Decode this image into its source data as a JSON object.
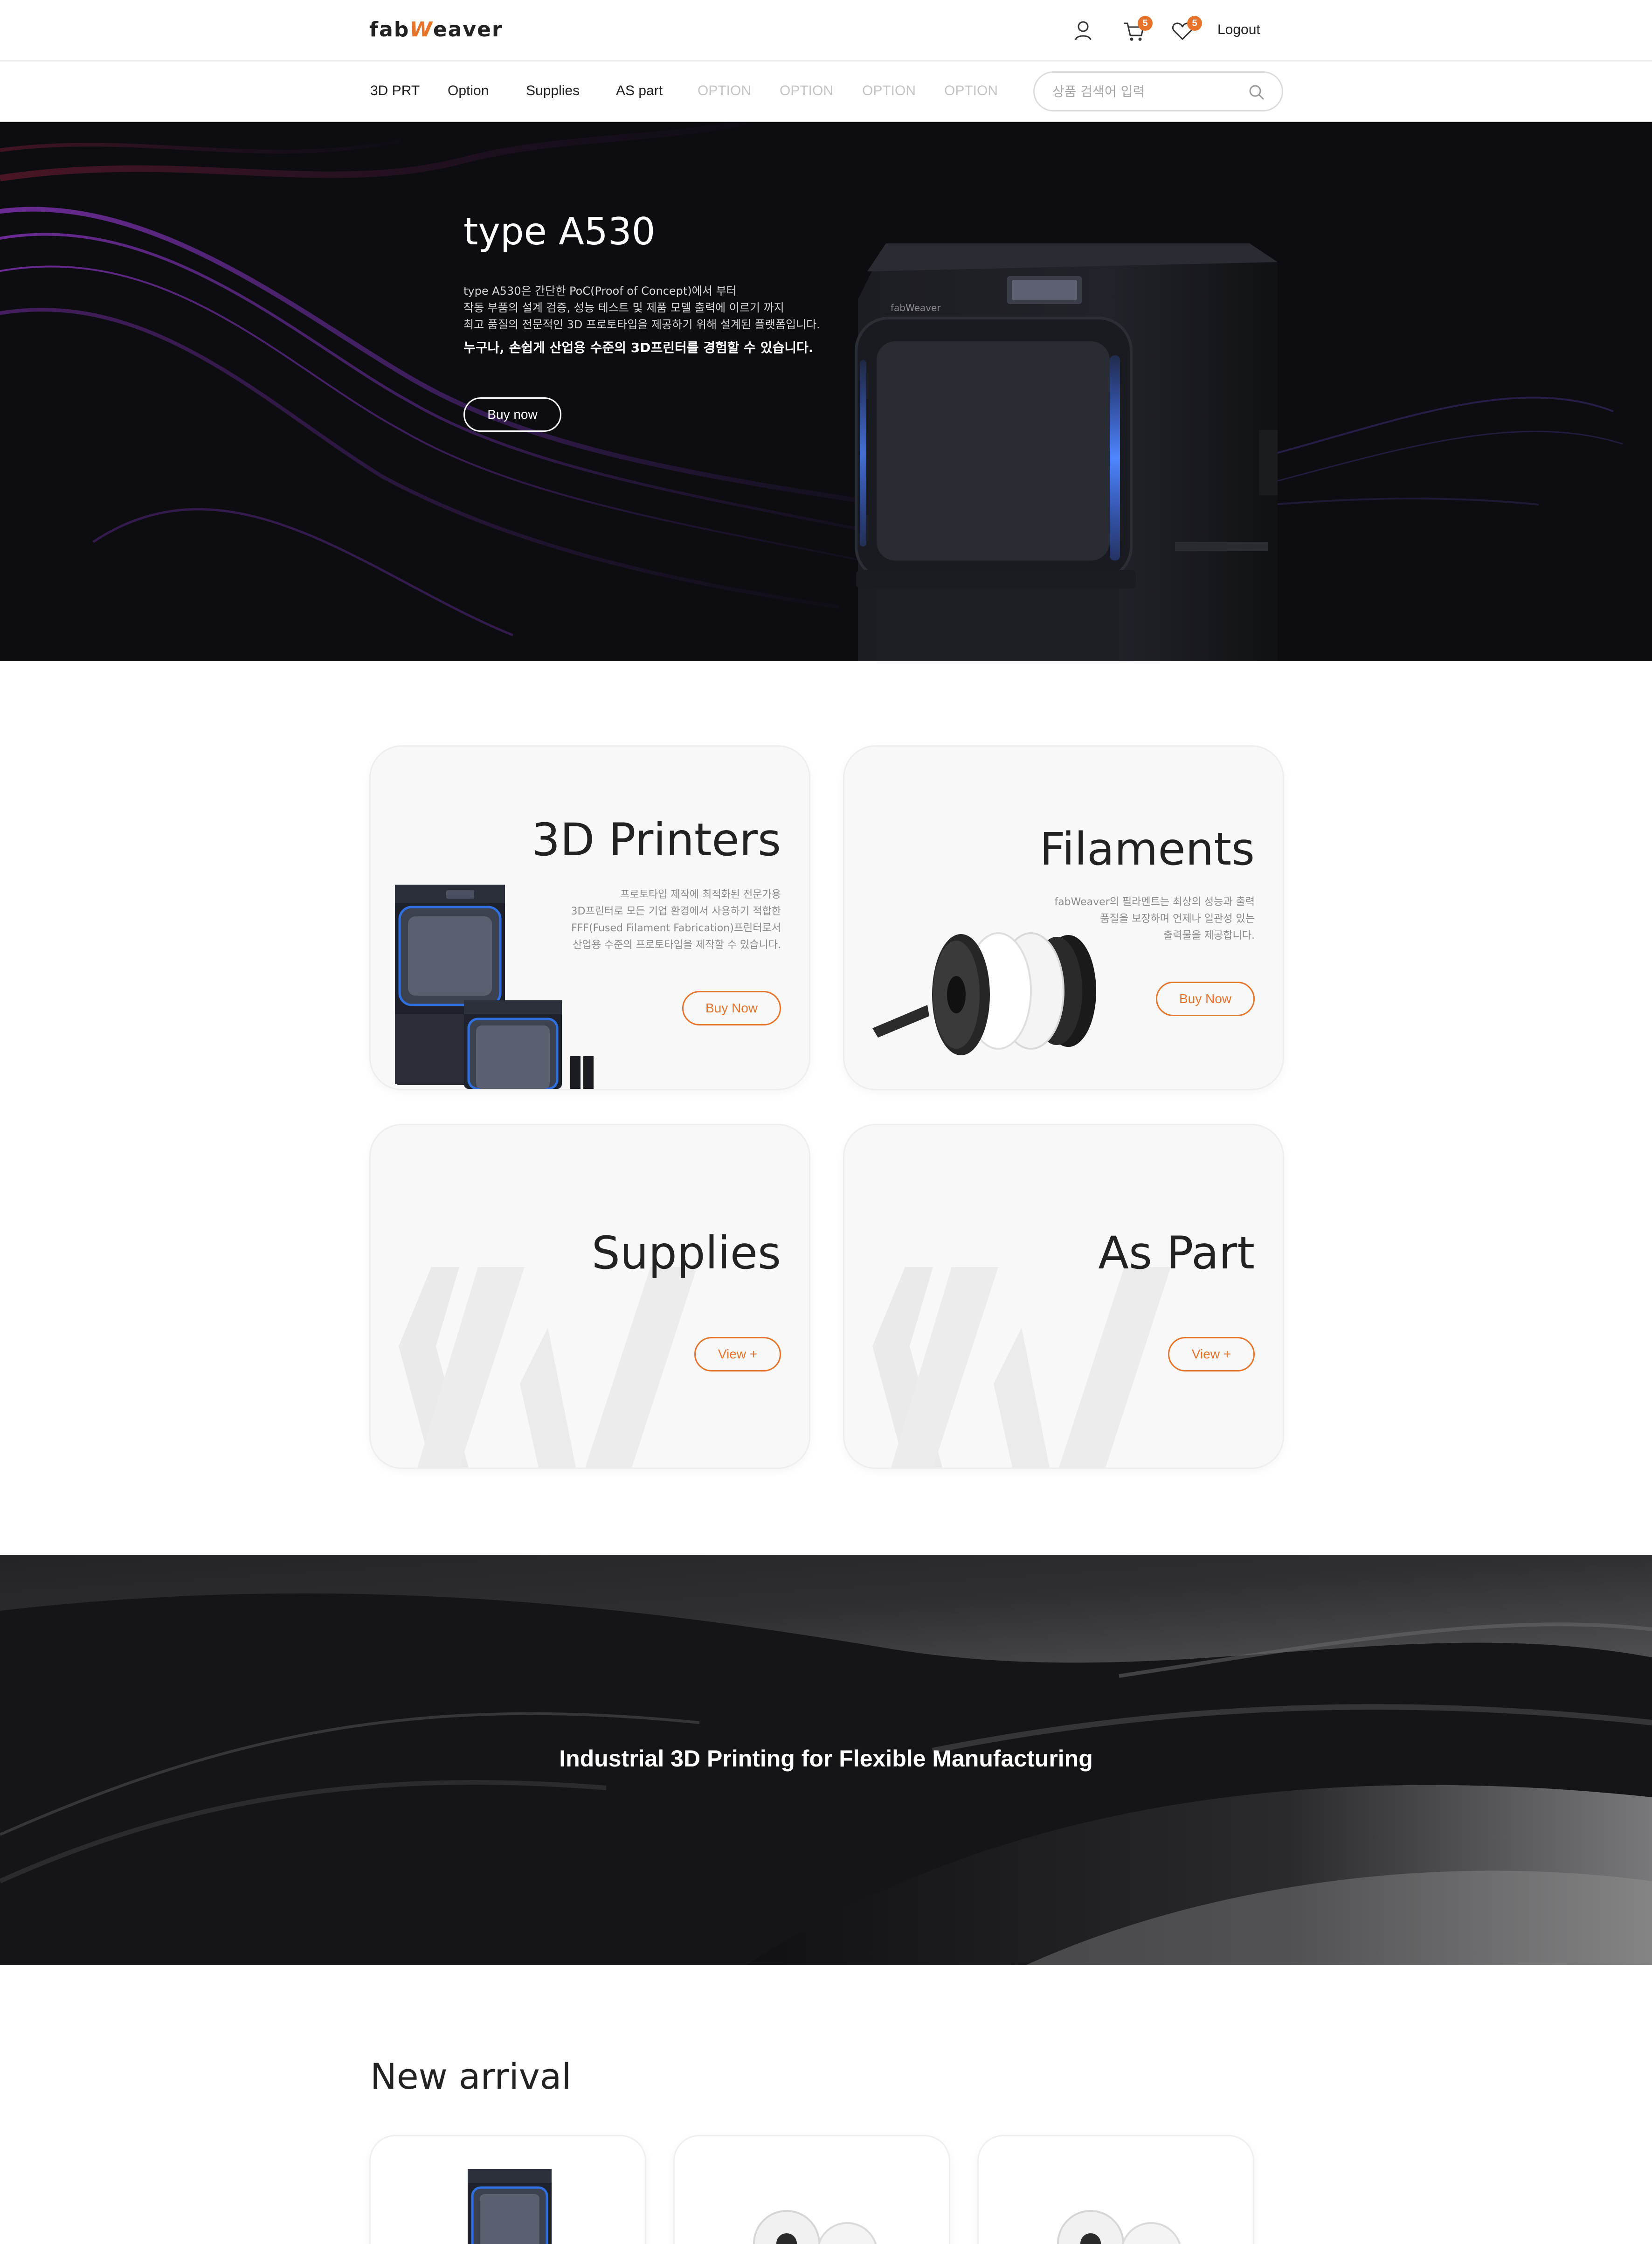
{
  "header": {
    "logo_text_a": "fab",
    "logo_text_w": "W",
    "logo_text_b": "eaver",
    "cart_count": "5",
    "wishlist_count": "5",
    "logout_label": "Logout",
    "icons": [
      "user-icon",
      "cart-icon",
      "heart-icon"
    ]
  },
  "nav": {
    "items": [
      "3D PRT",
      "Option",
      "Supplies",
      "AS part",
      "OPTION",
      "OPTION",
      "OPTION",
      "OPTION"
    ],
    "search_placeholder": "상품 검색어 입력"
  },
  "hero": {
    "title": "type A530",
    "desc_lines": [
      "type A530은 간단한 PoC(Proof of Concept)에서 부터",
      "작동 부품의 설계 검증, 성능 테스트 및 제품 모델 출력에 이르기 까지",
      "최고 품질의 전문적인 3D 프로토타입을 제공하기 위해 설계된 플랫폼입니다."
    ],
    "strong": "누구나, 손쉽게 산업용 수준의 3D프린터를 경험할 수 있습니다.",
    "button": "Buy now"
  },
  "categories": [
    {
      "title": "3D Printers",
      "desc_lines": [
        "프로토타입 제작에 최적화된 전문가용",
        "3D프린터로 모든 기업 환경에서 사용하기 적합한",
        "FFF(Fused Filament Fabrication)프린터로서",
        "산업용 수준의 프로토타입을 제작할 수 있습니다."
      ],
      "button": "Buy Now"
    },
    {
      "title": "Filaments",
      "desc_lines": [
        "fabWeaver의 필라멘트는 최상의 성능과 출력",
        "품질을 보장하며 언제나 일관성 있는",
        "출력물을 제공합니다."
      ],
      "button": "Buy Now"
    },
    {
      "title": "Supplies",
      "button": "View +"
    },
    {
      "title": "As Part",
      "button": "View +"
    }
  ],
  "banner": {
    "text": "Industrial 3D Printing for Flexible Manufacturing"
  },
  "new_arrival": {
    "title": "New arrival",
    "items": [
      "printer",
      "filament",
      "filament"
    ]
  },
  "colors": {
    "accent": "#e8742b",
    "hero_bg": "#0d0c10",
    "card_bg": "#f8f8f8"
  }
}
